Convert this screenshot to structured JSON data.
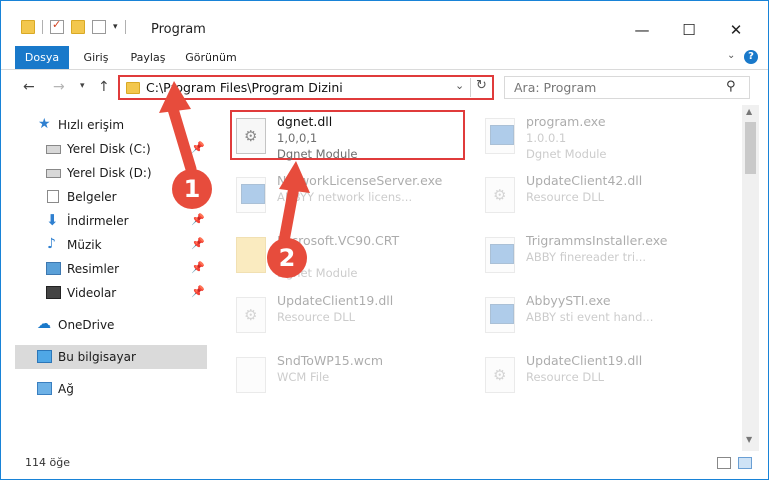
{
  "window": {
    "title": "Program"
  },
  "ribbon": {
    "tabs": [
      "Dosya",
      "Giriş",
      "Paylaş",
      "Görünüm"
    ]
  },
  "address": {
    "path": "C:\\Program Files\\Program Dizini"
  },
  "search": {
    "placeholder": "Ara: Program"
  },
  "sidebar": {
    "items": [
      {
        "label": "Hızlı erişim",
        "icon": "star-icon",
        "pinned": false
      },
      {
        "label": "Yerel Disk (C:)",
        "icon": "drive-icon",
        "pinned": true
      },
      {
        "label": "Yerel Disk (D:)",
        "icon": "drive-icon",
        "pinned": false
      },
      {
        "label": "Belgeler",
        "icon": "document-icon",
        "pinned": true
      },
      {
        "label": "İndirmeler",
        "icon": "download-icon",
        "pinned": true
      },
      {
        "label": "Müzik",
        "icon": "music-icon",
        "pinned": true
      },
      {
        "label": "Resimler",
        "icon": "pictures-icon",
        "pinned": true
      },
      {
        "label": "Videolar",
        "icon": "videos-icon",
        "pinned": true
      },
      {
        "label": "OneDrive",
        "icon": "cloud-icon",
        "pinned": false
      },
      {
        "label": "Bu bilgisayar",
        "icon": "computer-icon",
        "pinned": false,
        "selected": true
      },
      {
        "label": "Ağ",
        "icon": "network-icon",
        "pinned": false
      }
    ]
  },
  "files": [
    {
      "name": "dgnet.dll",
      "meta1": "1,0,0,1",
      "meta2": "Dgnet Module",
      "icon": "dll-icon",
      "highlighted": true
    },
    {
      "name": "program.exe",
      "meta1": "1.0.0.1",
      "meta2": "Dgnet Module",
      "icon": "exe-icon"
    },
    {
      "name": "NetworkLicenseServer.exe",
      "meta1": "ABBYY network licens...",
      "meta2": "",
      "icon": "exe-icon"
    },
    {
      "name": "UpdateClient42.dll",
      "meta1": "Resource DLL",
      "meta2": "",
      "icon": "dll-icon"
    },
    {
      "name": "Microsoft.VC90.CRT",
      "meta1": "",
      "meta2": "Dgnet Module",
      "icon": "folder-icon"
    },
    {
      "name": "TrigrammsInstaller.exe",
      "meta1": "ABBY finereader tri...",
      "meta2": "",
      "icon": "exe-icon"
    },
    {
      "name": "UpdateClient19.dll",
      "meta1": "Resource DLL",
      "meta2": "",
      "icon": "dll-icon"
    },
    {
      "name": "AbbyySTI.exe",
      "meta1": "ABBY sti event hand...",
      "meta2": "",
      "icon": "exe-icon"
    },
    {
      "name": "SndToWP15.wcm",
      "meta1": "WCM File",
      "meta2": "",
      "icon": "file-icon"
    },
    {
      "name": "UpdateClient19.dll",
      "meta1": "Resource DLL",
      "meta2": "",
      "icon": "dll-icon"
    }
  ],
  "callouts": [
    "1",
    "2"
  ],
  "status": {
    "count": "114 öğe"
  },
  "colors": {
    "accent": "#1979ca",
    "highlight": "#e03b3b",
    "badge": "#e74c3c"
  }
}
